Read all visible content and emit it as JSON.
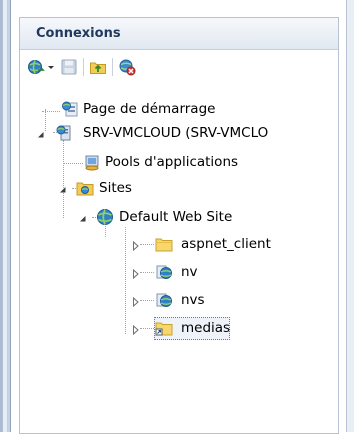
{
  "panel": {
    "title": "Connexions"
  },
  "toolbar": {
    "buttons": [
      {
        "name": "connect-icon"
      },
      {
        "name": "save-icon"
      },
      {
        "name": "up-folder-icon"
      },
      {
        "name": "disconnect-icon"
      }
    ]
  },
  "tree": {
    "items": [
      {
        "label": "Page de démarrage",
        "icon": "start-page-icon",
        "level": 0
      },
      {
        "label": "SRV-VMCLOUD (SRV-VMCLO",
        "icon": "server-icon",
        "level": 0,
        "expanded": true
      },
      {
        "label": "Pools d'applications",
        "icon": "app-pool-icon",
        "level": 1
      },
      {
        "label": "Sites",
        "icon": "sites-folder-icon",
        "level": 1,
        "expanded": true
      },
      {
        "label": "Default Web Site",
        "icon": "globe-icon",
        "level": 2,
        "expanded": true
      },
      {
        "label": "aspnet_client",
        "icon": "folder-icon",
        "level": 3,
        "expanded": false
      },
      {
        "label": "nv",
        "icon": "web-app-icon",
        "level": 3,
        "expanded": false
      },
      {
        "label": "nvs",
        "icon": "web-app-icon",
        "level": 3,
        "expanded": false
      },
      {
        "label": "medias",
        "icon": "virtual-dir-folder-icon",
        "level": 3,
        "expanded": false,
        "selected": true
      }
    ]
  },
  "colors": {
    "title": "#1e395b",
    "panel_border": "#b7c3d3",
    "header_gradient_top": "#f6f8fb",
    "header_gradient_bottom": "#e1e8f1"
  }
}
